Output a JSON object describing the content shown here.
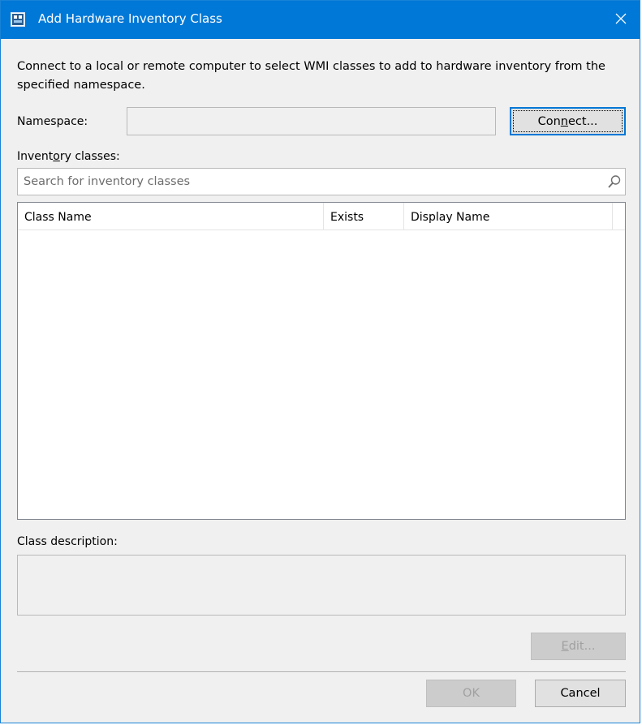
{
  "window": {
    "title": "Add Hardware Inventory Class",
    "icon": "wmi-class-icon",
    "close_icon": "close-icon",
    "accent_color": "#0078d7"
  },
  "intro_text": "Connect to a local or remote computer to select WMI classes to add to hardware inventory from the specified namespace.",
  "namespace": {
    "label": "Namespace:",
    "value": ""
  },
  "connect_button": {
    "label_pre": "Con",
    "label_accel": "n",
    "label_post": "ect..."
  },
  "inventory": {
    "label_pre": "Invent",
    "label_accel": "o",
    "label_post": "ry classes:"
  },
  "search": {
    "placeholder": "Search for inventory classes",
    "value": "",
    "icon": "search-icon"
  },
  "table": {
    "columns": [
      "Class Name",
      "Exists",
      "Display Name"
    ],
    "rows": []
  },
  "description": {
    "label": "Class description:",
    "value": ""
  },
  "edit_button": {
    "label_accel": "E",
    "label_post": "dit...",
    "enabled": false
  },
  "ok_button": {
    "label": "OK",
    "enabled": false
  },
  "cancel_button": {
    "label": "Cancel"
  }
}
